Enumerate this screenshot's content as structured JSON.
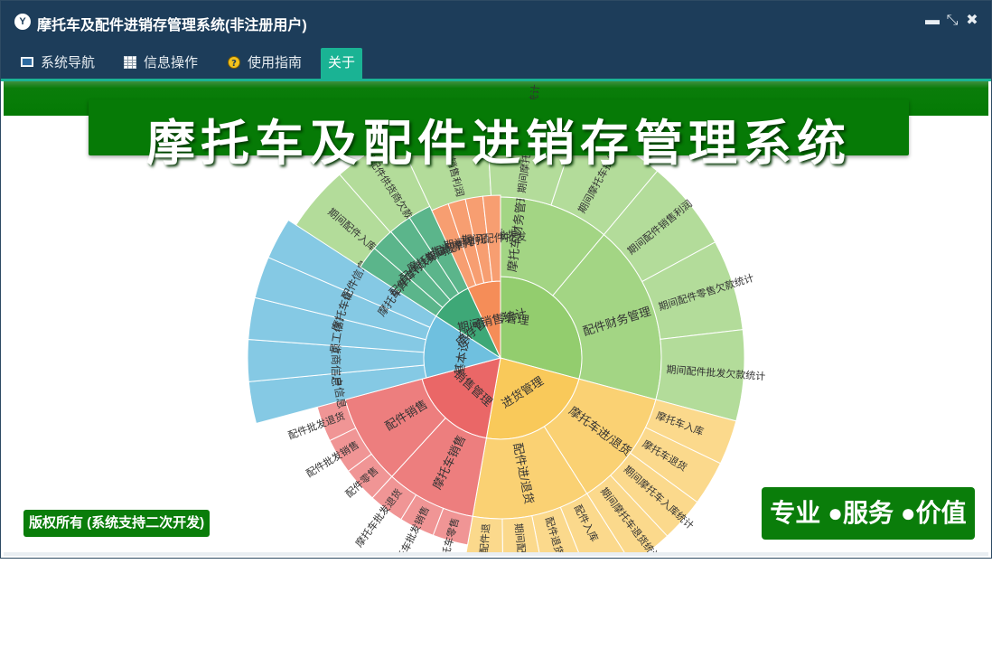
{
  "window": {
    "title": "摩托车及配件进销存管理系统(非注册用户)",
    "logo_glyph": "Y",
    "controls": {
      "minimize": "▬",
      "restore": "⤡",
      "close": "✖"
    }
  },
  "menu": [
    {
      "label": "系统导航",
      "icon": "monitor-icon"
    },
    {
      "label": "信息操作",
      "icon": "grid-icon"
    },
    {
      "label": "使用指南",
      "icon": "help-icon"
    },
    {
      "label": "关于",
      "icon": ""
    }
  ],
  "active_menu": "关于",
  "banner": {
    "title": "摩托车及配件进销存管理系统"
  },
  "footer": {
    "copyright": "版权所有 (系统支持二次开发)",
    "slogan": "专业 ●服务 ●价值"
  },
  "colors": {
    "titlebar": "#1d3d5a",
    "tab_active": "#1ab394",
    "banner_green": "#067a06",
    "finance": "#93cd6e",
    "purchase": "#f9c95a",
    "sales": "#ea6767",
    "basic": "#6fc0df",
    "inventory": "#3ea877",
    "reports": "#f58d58"
  },
  "sunburst": [
    {
      "name": "财务管理",
      "color": "#93cd6e",
      "children": [
        {
          "name": "进货财务管理",
          "children": [
            "期间摩托车入",
            "付摩托车供货",
            "期间配件入库",
            "付配件供货商欠款"
          ]
        },
        {
          "name": "摩托车财务管理",
          "children": [
            "期间摩托车销售利润",
            "期间摩托车零售欠款统计",
            "期间摩托车批发欠款统计"
          ]
        },
        {
          "name": "配件财务管理",
          "children": [
            "期间配件销售利润",
            "期间配件零售欠款统计",
            "期间配件批发欠款统计"
          ]
        }
      ]
    },
    {
      "name": "进货管理",
      "color": "#f9c95a",
      "children": [
        {
          "name": "摩托车进/退货",
          "children": [
            "摩托车入库",
            "摩托车退货",
            "期间摩托车入库统计",
            "期间摩托车退货统计"
          ]
        },
        {
          "name": "配件进/退货",
          "children": [
            "配件入库",
            "配件退货",
            "期间配件入库",
            "期间配件退"
          ]
        }
      ]
    },
    {
      "name": "销售管理",
      "color": "#ea6767",
      "children": [
        {
          "name": "摩托车销售",
          "children": [
            "摩托车零售",
            "摩托车批发销售",
            "摩托车批发退货"
          ]
        },
        {
          "name": "配件销售",
          "children": [
            "配件零售",
            "配件批发销售",
            "配件批发退货"
          ]
        }
      ]
    },
    {
      "name": "基本设置",
      "color": "#6fc0df",
      "children": [
        {
          "name": "客户信息"
        },
        {
          "name": "供货商信息"
        },
        {
          "name": "员工信息"
        },
        {
          "name": "摩托车信息"
        },
        {
          "name": "配件信息"
        }
      ]
    },
    {
      "name": "库存管理",
      "color": "#3ea877",
      "children": [
        {
          "name": "摩托车库存信息"
        },
        {
          "name": "配件库存信息"
        },
        {
          "name": "配件缺货信息"
        },
        {
          "name": "摩托车缺货信息"
        }
      ]
    },
    {
      "name": "期间销售统计",
      "color": "#f58d58",
      "children": [
        {
          "name": "期间配件零售"
        },
        {
          "name": "期间摩托车零售"
        },
        {
          "name": "期间摩托车批发"
        },
        {
          "name": "期间配件批发"
        }
      ]
    }
  ]
}
